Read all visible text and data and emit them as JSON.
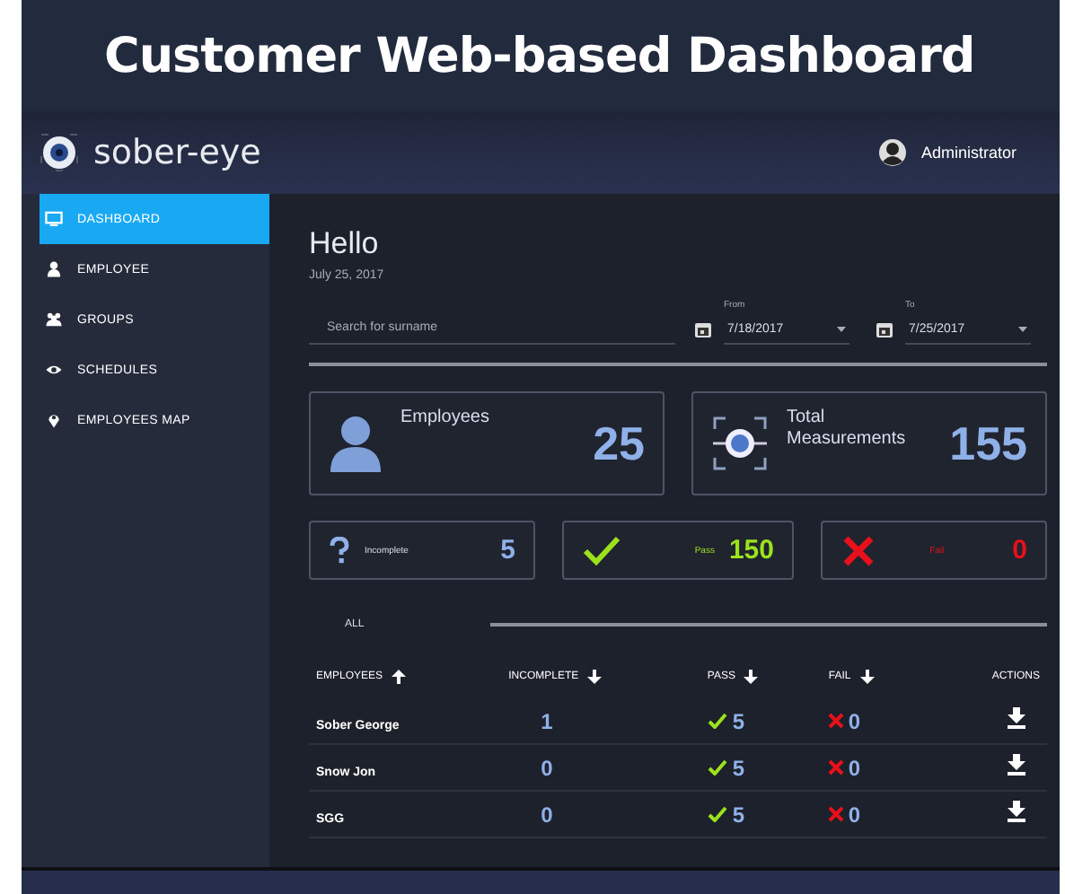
{
  "banner": {
    "title": "Customer Web-based Dashboard"
  },
  "header": {
    "brand": "sober-eye",
    "user": "Administrator"
  },
  "sidebar": {
    "items": [
      {
        "label": "DASHBOARD",
        "kind": "monitor",
        "selected": true
      },
      {
        "label": "EMPLOYEE",
        "kind": "person",
        "selected": false
      },
      {
        "label": "GROUPS",
        "kind": "group",
        "selected": false
      },
      {
        "label": "SCHEDULES",
        "kind": "eye",
        "selected": false
      },
      {
        "label": "EMPLOYEES MAP",
        "kind": "pin",
        "selected": false
      }
    ]
  },
  "greeting": {
    "title": "Hello",
    "date": "July 25, 2017"
  },
  "filters": {
    "search": {
      "placeholder": "Search for surname"
    },
    "from": {
      "label": "From",
      "value": "7/18/2017"
    },
    "to": {
      "label": "To",
      "value": "7/25/2017"
    }
  },
  "stats": [
    {
      "kind": "employees",
      "label": "Employees",
      "value": "25"
    },
    {
      "kind": "measurements",
      "label": "Total Measurements",
      "value": "155"
    }
  ],
  "results": [
    {
      "kind": "incomplete",
      "label": "Incomplete",
      "value": "5"
    },
    {
      "kind": "pass",
      "label": "Pass",
      "value": "150"
    },
    {
      "kind": "fail",
      "label": "Fail",
      "value": "0"
    }
  ],
  "filter_tab": {
    "label": "ALL"
  },
  "table": {
    "columns": [
      {
        "label": "EMPLOYEES",
        "kind": "ascending"
      },
      {
        "label": "INCOMPLETE",
        "kind": "descending"
      },
      {
        "label": "PASS",
        "kind": "descending"
      },
      {
        "label": "FAIL",
        "kind": "descending"
      },
      {
        "label": "ACTIONS",
        "kind": "plain"
      }
    ],
    "rows": [
      {
        "employee": "Sober George",
        "incomplete": "1",
        "pass": "5",
        "fail": "0"
      },
      {
        "employee": "Snow Jon",
        "incomplete": "0",
        "pass": "5",
        "fail": "0"
      },
      {
        "employee": "SGG",
        "incomplete": "0",
        "pass": "5",
        "fail": "0"
      }
    ]
  }
}
